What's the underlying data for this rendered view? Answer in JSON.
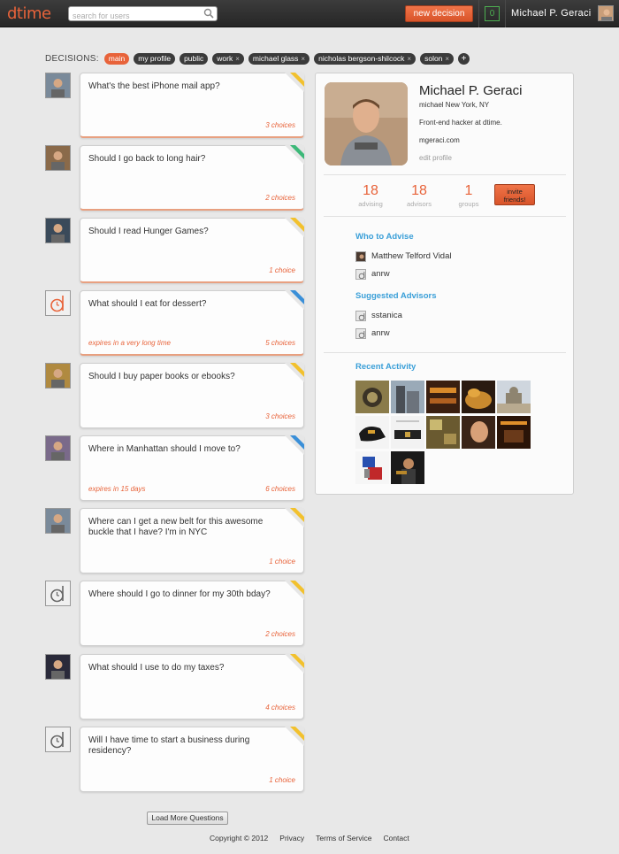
{
  "app": {
    "logo": "dtime"
  },
  "search": {
    "placeholder": "search for users"
  },
  "header": {
    "new_decision": "new decision",
    "notifications": "0",
    "user_name": "Michael P. Geraci"
  },
  "decisions": {
    "label": "DECISIONS:",
    "tags": [
      {
        "label": "main",
        "active": true
      },
      {
        "label": "my profile"
      },
      {
        "label": "public"
      },
      {
        "label": "work",
        "removable": true
      },
      {
        "label": "michael glass",
        "removable": true
      },
      {
        "label": "nicholas bergson-shilcock",
        "removable": true
      },
      {
        "label": "solon",
        "removable": true
      }
    ],
    "remove_glyph": "×",
    "add_glyph": "+"
  },
  "questions": [
    {
      "text": "What's the best iPhone mail app?",
      "choices": "3 choices",
      "corner": "yellow",
      "avatar": "photo"
    },
    {
      "text": "Should I go back to long hair?",
      "choices": "2 choices",
      "corner": "green",
      "avatar": "photo"
    },
    {
      "text": "Should I read Hunger Games?",
      "choices": "1 choice",
      "corner": "yellow",
      "avatar": "photo"
    },
    {
      "text": "What should I eat for dessert?",
      "choices": "5 choices",
      "expires": "expires in a very long time",
      "corner": "blue",
      "avatar": "dtime"
    },
    {
      "text": "Should I buy paper books or ebooks?",
      "choices": "3 choices",
      "corner": "yellow",
      "avatar": "photo"
    },
    {
      "text": "Where in Manhattan should I move to?",
      "choices": "6 choices",
      "expires": "expires in 15 days",
      "corner": "blue",
      "avatar": "photo"
    },
    {
      "text": "Where can I get a new belt for this awesome buckle that I have? I'm in NYC",
      "choices": "1 choice",
      "corner": "yellow",
      "avatar": "photo"
    },
    {
      "text": "Where should I go to dinner for my 30th bday?",
      "choices": "2 choices",
      "corner": "yellow",
      "avatar": "dtime"
    },
    {
      "text": "What should I use to do my taxes?",
      "choices": "4 choices",
      "corner": "yellow",
      "avatar": "photo"
    },
    {
      "text": "Will I have time to start a business during residency?",
      "choices": "1 choice",
      "corner": "yellow",
      "avatar": "dtime"
    }
  ],
  "load_more": "Load More Questions",
  "footer": {
    "copyright": "Copyright © 2012",
    "privacy": "Privacy",
    "terms": "Terms of Service",
    "contact": "Contact"
  },
  "profile": {
    "name": "Michael P. Geraci",
    "location": "michael New York, NY",
    "bio": "Front-end hacker at dtime.",
    "website": "mgeraci.com",
    "edit": "edit profile",
    "stats": {
      "advising": {
        "value": "18",
        "label": "advising"
      },
      "advisors": {
        "value": "18",
        "label": "advisors"
      },
      "groups": {
        "value": "1",
        "label": "groups"
      }
    },
    "invite": "invite friends!",
    "who_to_advise_title": "Who to Advise",
    "who_to_advise": [
      "Matthew Telford Vidal",
      "anrw"
    ],
    "suggested_title": "Suggested Advisors",
    "suggested": [
      "sstanica",
      "anrw"
    ],
    "recent_title": "Recent Activity"
  },
  "colors": {
    "accent": "#e8633a",
    "link": "#3a9fd8",
    "corner_yellow": "#f2c12e",
    "corner_green": "#3cb878",
    "corner_blue": "#3a8fd8"
  }
}
